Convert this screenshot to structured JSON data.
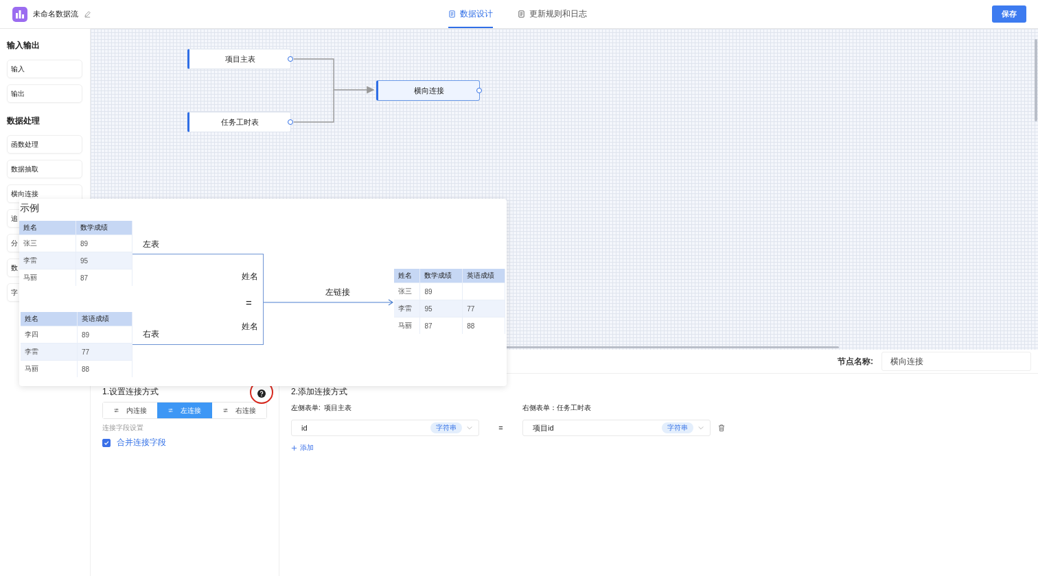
{
  "header": {
    "title": "未命名数据流",
    "tabs": [
      {
        "label": "数据设计",
        "selected": true
      },
      {
        "label": "更新规则和日志",
        "selected": false
      }
    ],
    "save": "保存"
  },
  "sidebar": {
    "groups": [
      {
        "title": "输入输出",
        "items": [
          "输入",
          "输出"
        ]
      },
      {
        "title": "数据处理",
        "items": [
          "函数处理",
          "数据抽取",
          "横向连接",
          "追",
          "分",
          "数",
          "字"
        ]
      }
    ]
  },
  "canvas": {
    "nodes": [
      {
        "label": "项目主表",
        "selected": false
      },
      {
        "label": "任务工时表",
        "selected": false
      },
      {
        "label": "横向连接",
        "selected": true
      }
    ]
  },
  "example": {
    "title": "示例",
    "left_label": "左表",
    "right_label": "右表",
    "left_key": "姓名",
    "operator": "=",
    "right_key": "姓名",
    "join_label": "左链接",
    "left_table": {
      "columns": [
        "姓名",
        "数学成绩"
      ],
      "rows": [
        [
          "张三",
          "89"
        ],
        [
          "李雷",
          "95"
        ],
        [
          "马丽",
          "87"
        ]
      ]
    },
    "right_table": {
      "columns": [
        "姓名",
        "英语成绩"
      ],
      "rows": [
        [
          "李四",
          "89"
        ],
        [
          "李雷",
          "77"
        ],
        [
          "马丽",
          "88"
        ]
      ]
    },
    "result_table": {
      "columns": [
        "姓名",
        "数学成绩",
        "英语成绩"
      ],
      "rows": [
        [
          "张三",
          "89",
          ""
        ],
        [
          "李雷",
          "95",
          "77"
        ],
        [
          "马丽",
          "87",
          "88"
        ]
      ]
    }
  },
  "node_name": {
    "label": "节点名称:",
    "value": "横向连接"
  },
  "join": {
    "title": "1.设置连接方式",
    "options": [
      {
        "label": "内连接",
        "selected": false
      },
      {
        "label": "左连接",
        "selected": true
      },
      {
        "label": "右连接",
        "selected": false
      }
    ],
    "field_setting_label": "连接字段设置",
    "merge": {
      "label": "合并连接字段",
      "checked": true
    }
  },
  "conditions": {
    "title": "2.添加连接方式",
    "left_label": "左侧表单:  项目主表",
    "right_label": "右侧表单：任务工时表",
    "rows": [
      {
        "left": {
          "value": "id",
          "type": "字符串"
        },
        "operator": "=",
        "right": {
          "value": "项目id",
          "type": "字符串"
        }
      }
    ],
    "add": "添加"
  }
}
